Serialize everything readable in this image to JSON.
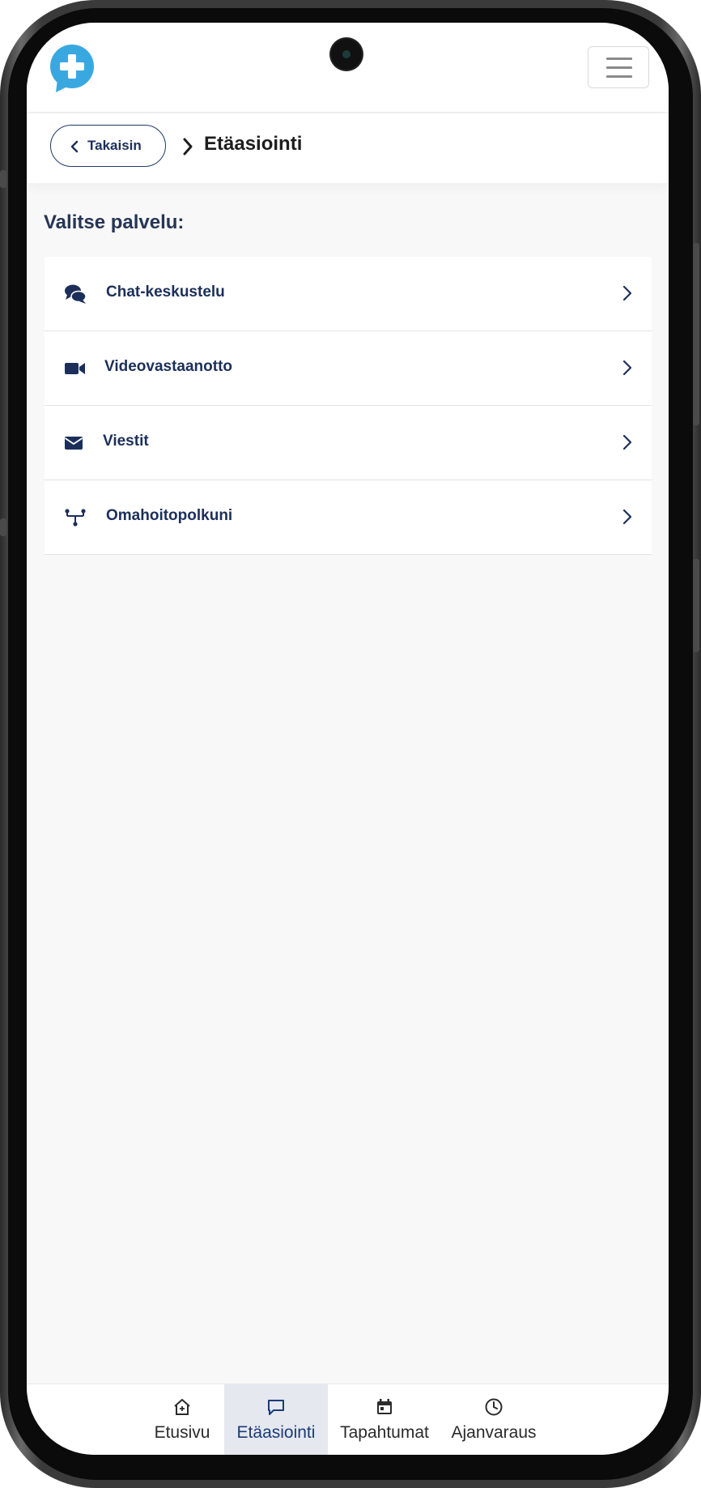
{
  "header": {
    "logo_icon": "medical-cross-chat-icon",
    "menu_icon": "hamburger-icon",
    "accent_color": "#3aa8e0"
  },
  "breadcrumb": {
    "back_label": "Takaisin",
    "current": "Etäasiointi"
  },
  "main": {
    "heading": "Valitse palvelu:",
    "services": [
      {
        "label": "Chat-keskustelu",
        "icon": "chat-bubbles-icon"
      },
      {
        "label": "Videovastaanotto",
        "icon": "video-camera-icon"
      },
      {
        "label": "Viestit",
        "icon": "envelope-icon"
      },
      {
        "label": "Omahoitopolkuni",
        "icon": "care-path-icon"
      }
    ]
  },
  "bottom_nav": {
    "items": [
      {
        "label": "Etusivu",
        "icon": "home-icon",
        "active": false
      },
      {
        "label": "Etäasiointi",
        "icon": "message-icon",
        "active": true
      },
      {
        "label": "Tapahtumat",
        "icon": "calendar-icon",
        "active": false
      },
      {
        "label": "Ajanvaraus",
        "icon": "clock-icon",
        "active": false
      }
    ]
  },
  "colors": {
    "primary_text": "#1c2f5a",
    "nav_active_bg": "#e5e8ef"
  }
}
